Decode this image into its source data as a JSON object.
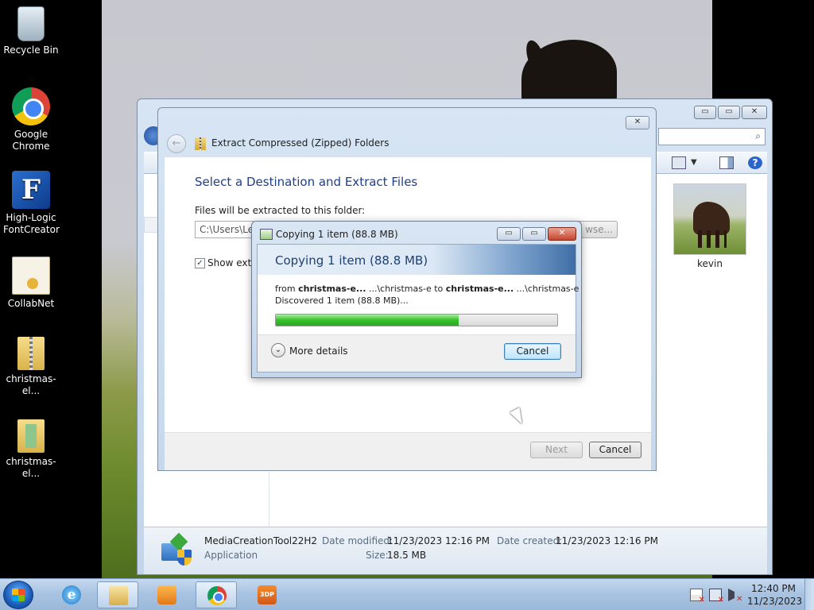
{
  "desktop": {
    "icons": [
      {
        "label": "Recycle Bin"
      },
      {
        "label": "Google Chrome"
      },
      {
        "label": "High-Logic FontCreator"
      },
      {
        "label": "CollabNet"
      },
      {
        "label": "christmas-el..."
      },
      {
        "label": "christmas-el..."
      }
    ]
  },
  "explorer": {
    "search_glyph": "⌕",
    "caption": {
      "minimize": "▭",
      "maximize": "▭",
      "close": "✕"
    },
    "toolbar": {
      "views_arrow": "▼",
      "help": "?"
    },
    "thumbnail": {
      "label": "kevin"
    },
    "details": {
      "name": "MediaCreationTool22H2",
      "type": "Application",
      "modified_label": "Date modified:",
      "modified_value": "11/23/2023 12:16 PM",
      "created_label": "Date created:",
      "created_value": "11/23/2023 12:16 PM",
      "size_label": "Size:",
      "size_value": "18.5 MB"
    }
  },
  "wizard": {
    "close": "✕",
    "back": "←",
    "title": "Extract Compressed (Zipped) Folders",
    "heading": "Select a Destination and Extract Files",
    "path_label": "Files will be extracted to this folder:",
    "path_value": "C:\\Users\\Lee",
    "browse_label": "wse...",
    "show_check": "✓",
    "show_label": "Show extra",
    "next_label": "Next",
    "cancel_label": "Cancel"
  },
  "copy_dialog": {
    "title": "Copying 1 item (88.8 MB)",
    "caption": {
      "minimize": "▭",
      "maximize": "▭",
      "close": "✕"
    },
    "banner": "Copying 1 item (88.8 MB)",
    "from_prefix": "from",
    "from_src": "christmas-e...",
    "from_src_path": "...\\christmas-e",
    "to_word": "to",
    "from_dst": "christmas-e...",
    "from_dst_path": "...\\christmas-e",
    "discovered": "Discovered 1 item (88.8 MB)...",
    "progress_fraction": 0.65,
    "chevron": "⌄",
    "more_details": "More details",
    "cancel_label": "Cancel"
  },
  "taskbar": {
    "ie_glyph": "e",
    "threedp_glyph": "3DP",
    "time": "12:40 PM",
    "date": "11/23/2023"
  }
}
